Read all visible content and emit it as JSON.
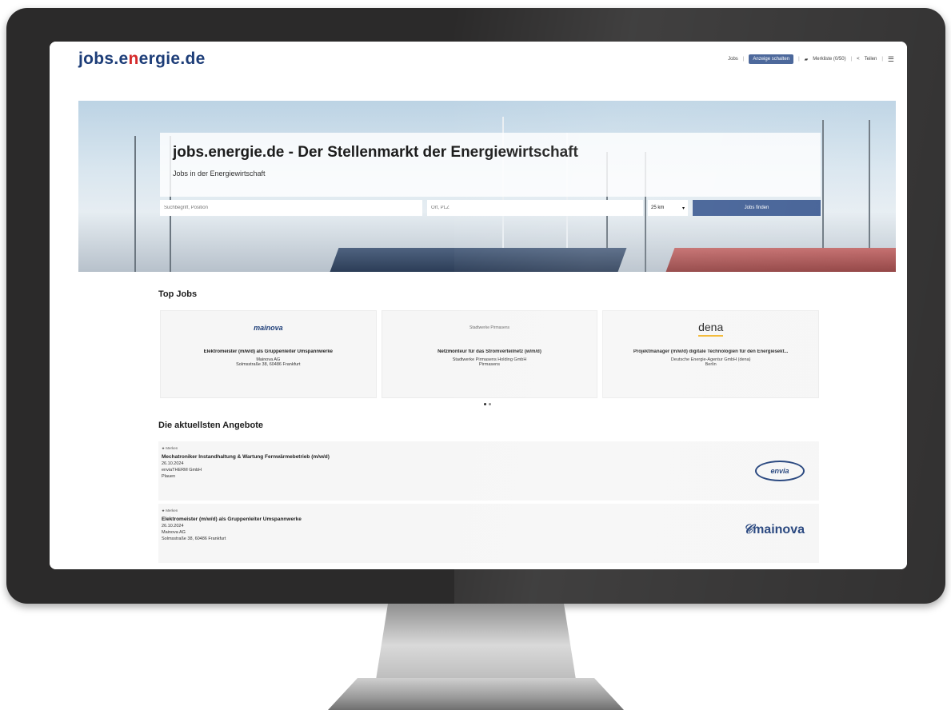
{
  "header": {
    "logo_text_left": "jobs.e",
    "logo_text_accent": "n",
    "logo_text_right": "ergie.de",
    "nav": {
      "jobs": "Jobs",
      "post_ad": "Anzeige schalten",
      "watchlist": "Merkliste (0/50)",
      "share": "Teilen",
      "menu_icon": "hamburger-menu-icon"
    }
  },
  "hero": {
    "title": "jobs.energie.de - Der Stellenmarkt der Energiewirtschaft",
    "subtitle": "Jobs in der Energiewirtschaft",
    "search": {
      "what_placeholder": "Suchbegriff, Position",
      "where_placeholder": "Ort, PLZ",
      "radius_value": "25 km",
      "button_label": "Jobs finden"
    }
  },
  "top_jobs": {
    "heading": "Top Jobs",
    "cards": [
      {
        "logo": "mainova",
        "title": "Elektromeister (m/w/d) als Gruppenleiter Umspannwerke",
        "company": "Mainova AG",
        "location": "Solmsstraße 38, 60486 Frankfurt"
      },
      {
        "logo": "Stadtwerke Pirmasens",
        "title": "Netzmonteur für das Stromverteilnetz (w/m/d)",
        "company": "Stadtwerke Pirmasens Holding GmbH",
        "location": "Pirmasens"
      },
      {
        "logo": "dena",
        "title": "Projektmanager (m/w/d) digitale Technologien für den Energiesekt...",
        "company": "Deutsche Energie-Agentur GmbH (dena)",
        "location": "Berlin"
      }
    ]
  },
  "latest": {
    "heading": "Die aktuellsten Angebote",
    "listings": [
      {
        "watch": "Merken",
        "title": "Mechatroniker Instandhaltung & Wartung Fernwärmebetrieb (m/w/d)",
        "date": "26.10.2024",
        "company": "enviaTHERM GmbH",
        "location": "Plauen",
        "logo": "envia"
      },
      {
        "watch": "Merken",
        "title": "Elektromeister (m/w/d) als Gruppenleiter Umspannwerke",
        "date": "26.10.2024",
        "company": "Mainova AG",
        "location": "Solmsstraße 38, 60486 Frankfurt",
        "logo": "mainova"
      }
    ]
  },
  "colors": {
    "brand_blue": "#1d3d78",
    "accent_red": "#d52b2b",
    "button_blue": "#3e5c93"
  }
}
